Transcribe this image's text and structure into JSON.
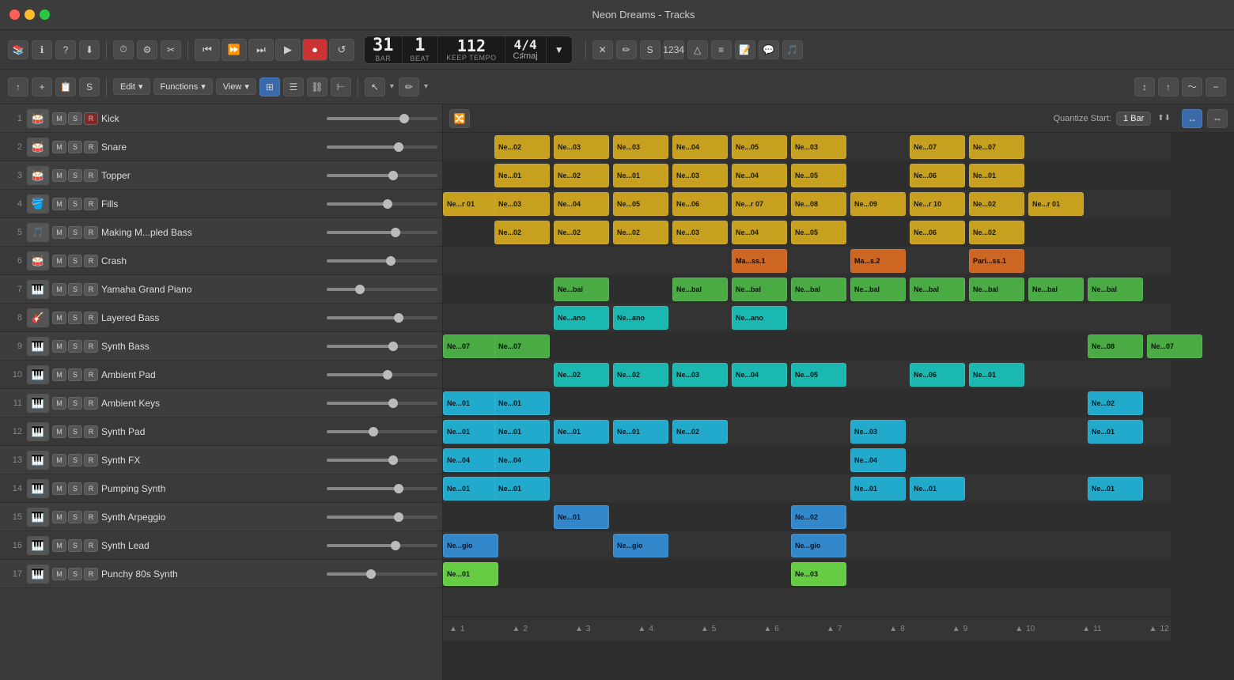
{
  "titlebar": {
    "title": "Neon Dreams - Tracks"
  },
  "toolbar": {
    "edit_label": "Edit",
    "functions_label": "Functions",
    "view_label": "View",
    "transport": {
      "rewind": "⏮",
      "fast_forward": "⏭",
      "skip_back": "⏮",
      "play": "▶",
      "record": "●",
      "cycle": "↺",
      "bar": "31",
      "beat": "1",
      "bar_label": "BAR",
      "beat_label": "BEAT",
      "tempo": "112",
      "tempo_label": "KEEP TEMPO",
      "key": "C♯maj",
      "time_sig": "4/4"
    }
  },
  "arrangement": {
    "quantize_label": "Quantize Start:",
    "quantize_value": "1 Bar"
  },
  "tracks": [
    {
      "num": 1,
      "name": "Kick",
      "icon": "🥁",
      "fader": 70
    },
    {
      "num": 2,
      "name": "Snare",
      "icon": "🥁",
      "fader": 65
    },
    {
      "num": 3,
      "name": "Topper",
      "icon": "🥁",
      "fader": 60
    },
    {
      "num": 4,
      "name": "Fills",
      "icon": "🪣",
      "fader": 55
    },
    {
      "num": 5,
      "name": "Making M...pled Bass",
      "icon": "🎵",
      "fader": 62
    },
    {
      "num": 6,
      "name": "Crash",
      "icon": "🥁",
      "fader": 58
    },
    {
      "num": 7,
      "name": "Yamaha Grand Piano",
      "icon": "🎹",
      "fader": 30
    },
    {
      "num": 8,
      "name": "Layered Bass",
      "icon": "🎸",
      "fader": 65
    },
    {
      "num": 9,
      "name": "Synth Bass",
      "icon": "🎹",
      "fader": 60
    },
    {
      "num": 10,
      "name": "Ambient Pad",
      "icon": "🎹",
      "fader": 55
    },
    {
      "num": 11,
      "name": "Ambient Keys",
      "icon": "🎹",
      "fader": 60
    },
    {
      "num": 12,
      "name": "Synth Pad",
      "icon": "🎹",
      "fader": 42
    },
    {
      "num": 13,
      "name": "Synth FX",
      "icon": "🎹",
      "fader": 60
    },
    {
      "num": 14,
      "name": "Pumping Synth",
      "icon": "🎹",
      "fader": 65
    },
    {
      "num": 15,
      "name": "Synth Arpeggio",
      "icon": "🎹",
      "fader": 65
    },
    {
      "num": 16,
      "name": "Synth Lead",
      "icon": "🎹",
      "fader": 62
    },
    {
      "num": 17,
      "name": "Punchy 80s Synth",
      "icon": "🎹",
      "fader": 40
    }
  ],
  "bar_markers": [
    1,
    2,
    3,
    4,
    5,
    6,
    7,
    8,
    9,
    10,
    11,
    12
  ]
}
